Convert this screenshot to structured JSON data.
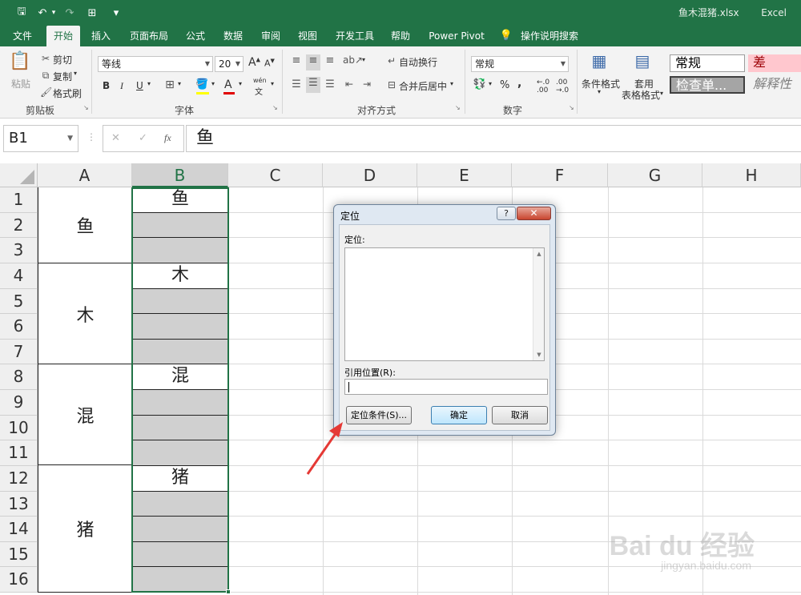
{
  "window": {
    "doc_title": "鱼木混猪.xlsx",
    "app_name": "Excel"
  },
  "qat": {
    "save": "🖫",
    "undo": "↶",
    "redo": "↷",
    "form": "⊞",
    "customize": "▾"
  },
  "tabs": [
    "文件",
    "开始",
    "插入",
    "页面布局",
    "公式",
    "数据",
    "审阅",
    "视图",
    "开发工具",
    "帮助",
    "Power Pivot"
  ],
  "active_tab": "开始",
  "tell_me": "操作说明搜索",
  "ribbon": {
    "clipboard": {
      "paste": "粘贴",
      "cut": "剪切",
      "copy": "复制",
      "format_painter": "格式刷",
      "label": "剪贴板"
    },
    "font": {
      "name": "等线",
      "size": "20",
      "grow": "A",
      "shrink": "A",
      "bold": "B",
      "italic": "I",
      "underline": "U",
      "phonetic": "wén",
      "label": "字体"
    },
    "alignment": {
      "wrap": "自动换行",
      "merge": "合并后居中",
      "label": "对齐方式"
    },
    "number": {
      "format": "常规",
      "percent": "%",
      "comma": ",",
      "label": "数字"
    },
    "styles": {
      "conditional": "条件格式",
      "table_line1": "套用",
      "table_line2": "表格格式",
      "normal": "常规",
      "bad": "差",
      "check": "检查单...",
      "explanatory": "解释性"
    }
  },
  "formula_bar": {
    "name_box": "B1",
    "cancel": "✕",
    "enter": "✓",
    "fx": "fx",
    "content": "鱼"
  },
  "grid": {
    "columns": [
      "A",
      "B",
      "C",
      "D",
      "E",
      "F",
      "G",
      "H"
    ],
    "rows": [
      "1",
      "2",
      "3",
      "4",
      "5",
      "6",
      "7",
      "8",
      "9",
      "10",
      "11",
      "12",
      "13",
      "14",
      "15",
      "16"
    ],
    "column_a_merged": [
      "鱼",
      "木",
      "混",
      "猪"
    ],
    "column_b_values": [
      "鱼",
      "木",
      "混",
      "猪"
    ]
  },
  "dialog": {
    "title": "定位",
    "help": "?",
    "close": "✕",
    "goto_label": "定位:",
    "reference_label": "引用位置(R):",
    "special_button": "定位条件(S)...",
    "ok_button": "确定",
    "cancel_button": "取消"
  },
  "watermark": {
    "brand": "Bai du 经验",
    "url": "jingyan.baidu.com"
  }
}
